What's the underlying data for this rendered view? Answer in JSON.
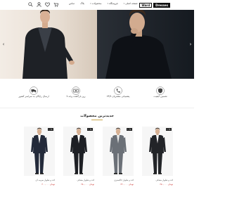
{
  "header": {
    "logo": [
      "Ward",
      "Dresses"
    ],
    "nav": [
      {
        "label": "صفحه اصلی"
      },
      {
        "label": "فروشگاه"
      },
      {
        "label": "محصولات"
      },
      {
        "label": "بلاگ"
      },
      {
        "label": "تماس"
      }
    ],
    "icons": [
      "search-icon",
      "user-icon",
      "heart-icon",
      "cart-icon"
    ]
  },
  "hero": {
    "prev_icon": "‹",
    "next_icon": "›"
  },
  "features": [
    {
      "icon": "shield-icon",
      "text": "تضمین کیفیت"
    },
    {
      "icon": "phone-icon",
      "text": "۲۴/۷ پشتیبانی مشتریان"
    },
    {
      "icon": "money-icon",
      "text": "۷ روز بازگشت وجه"
    },
    {
      "icon": "truck-icon",
      "text": "ارسال رایگان به سراسر کشور"
    }
  ],
  "products_section": {
    "title": "جدیدترین محصولات"
  },
  "products": [
    {
      "badge": "۱۰%",
      "name": "کت و شلوار مشکی",
      "price": "۳۵۰,۰۰۰ تومان",
      "old_price": "",
      "suit": "#222428",
      "shirt": "#f5f5f5"
    },
    {
      "badge": "۱۰%",
      "name": "کت و شلوار خاکستری",
      "price": "۳۲۰,۰۰۰ تومان",
      "old_price": "",
      "suit": "#6b7077",
      "shirt": "#eaeaea"
    },
    {
      "badge": "۱۰%",
      "name": "کت و شلوار مشکی",
      "price": "۲۸۰,۰۰۰ تومان",
      "old_price": "",
      "suit": "#1d1f24",
      "shirt": "#ffffff"
    },
    {
      "badge": "۱۰%",
      "name": "کت و شلوار سرمه ای",
      "price": "۳۰۰,۰۰۰ تومان",
      "old_price": "",
      "suit": "#232a3a",
      "shirt": "#ffffff"
    }
  ]
}
